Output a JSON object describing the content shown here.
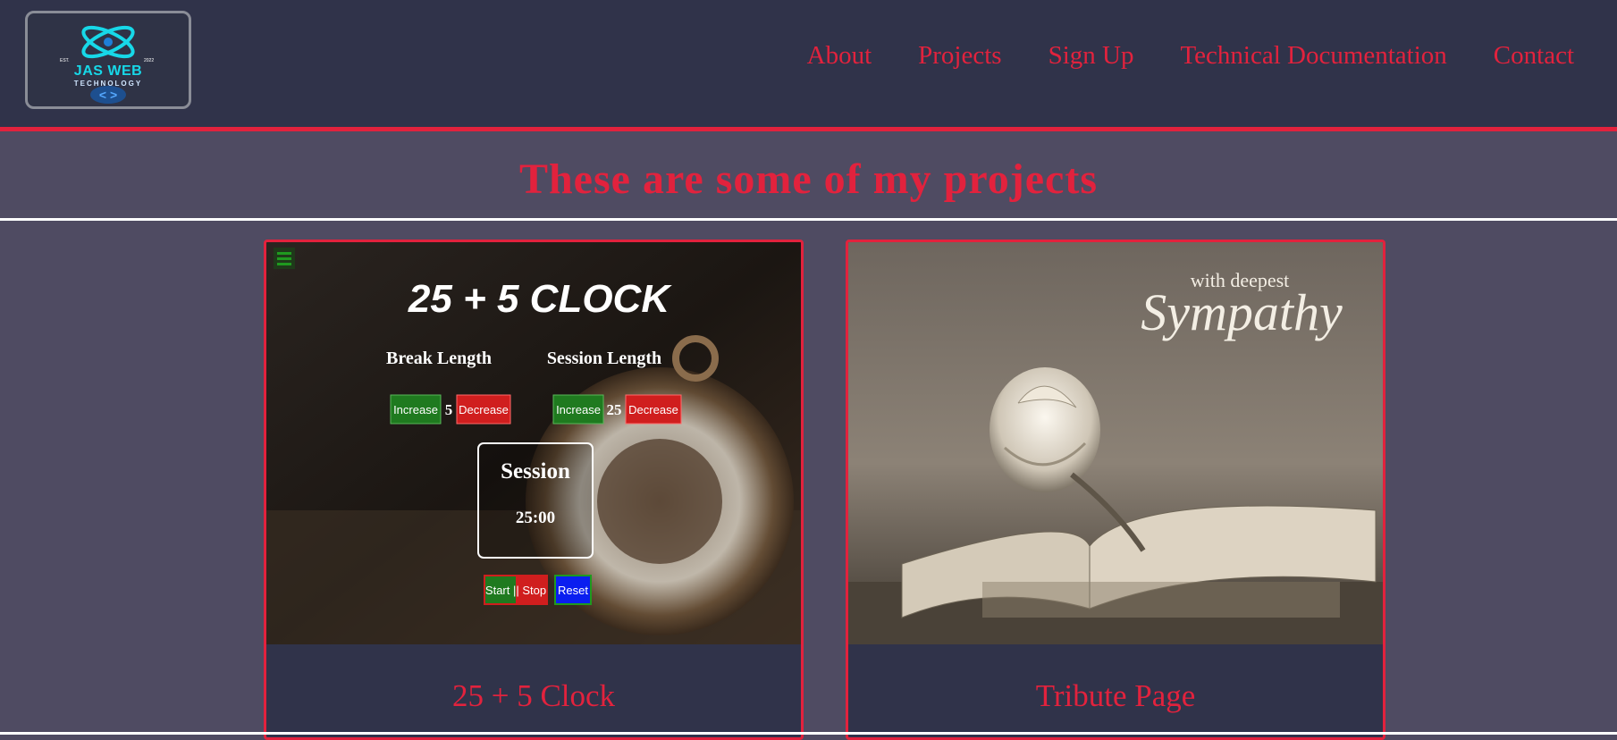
{
  "logo": {
    "brand": "JAS WEB",
    "sub": "TECHNOLOGY",
    "est": "EST.",
    "year": "2022",
    "code_glyph": "< >"
  },
  "nav": {
    "items": [
      "About",
      "Projects",
      "Sign Up",
      "Technical Documentation",
      "Contact"
    ]
  },
  "page": {
    "heading": "These are some of my projects"
  },
  "projects": [
    {
      "title": "25 + 5 Clock",
      "screenshot": {
        "app_title": "25 + 5 CLOCK",
        "break_label": "Break Length",
        "session_label": "Session Length",
        "increase": "Increase",
        "decrease": "Decrease",
        "break_value": "5",
        "session_value": "25",
        "timer_label": "Session",
        "timer_value": "25:00",
        "start_stop": "Start || Stop",
        "reset": "Reset"
      }
    },
    {
      "title": "Tribute Page",
      "screenshot": {
        "small_text": "with deepest",
        "script_text": "Sympathy"
      }
    }
  ],
  "colors": {
    "accent": "#e2223d",
    "nav_bg": "#30334a",
    "page_bg": "#4f4b62",
    "logo_cyan": "#17d8e8"
  }
}
